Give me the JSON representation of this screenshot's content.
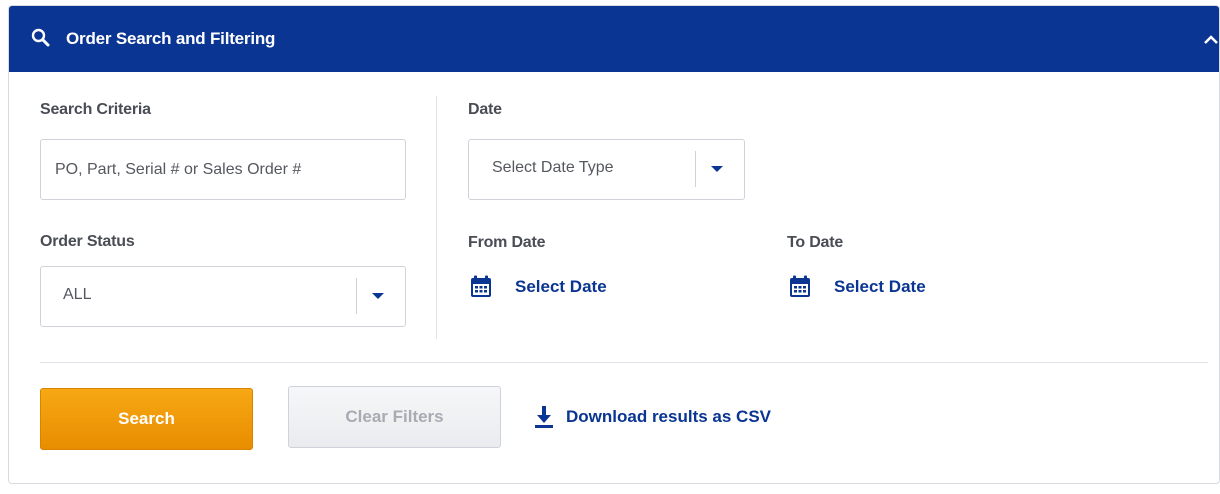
{
  "header": {
    "title": "Order Search and Filtering",
    "icon": "search-icon",
    "toggle_icon": "chevron-up-icon",
    "background_color": "#0a3592"
  },
  "search_criteria": {
    "label": "Search Criteria",
    "placeholder": "PO, Part, Serial # or Sales Order #"
  },
  "order_status": {
    "label": "Order Status",
    "value": "ALL"
  },
  "date": {
    "label": "Date",
    "type_value": "Select Date Type",
    "from_label": "From Date",
    "from_value": "Select Date",
    "to_label": "To Date",
    "to_value": "Select Date",
    "icon": "calendar-icon"
  },
  "actions": {
    "search_label": "Search",
    "clear_label": "Clear Filters",
    "download_label": "Download results as CSV",
    "download_icon": "download-icon",
    "search_color": "#f0a000",
    "link_color": "#0a3592"
  }
}
